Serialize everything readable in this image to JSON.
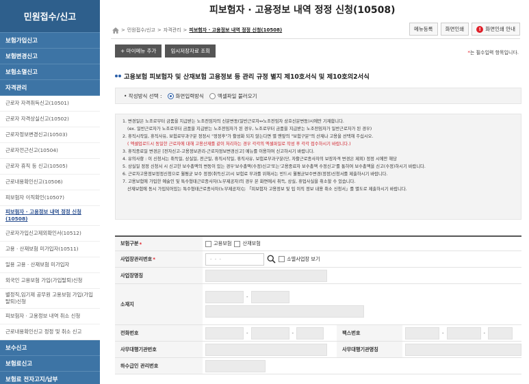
{
  "sidebar": {
    "title": "민원접수/신고",
    "categories_top": [
      "보험가입신고",
      "보험변경신고",
      "보험소멸신고",
      "자격관리"
    ],
    "items": [
      "근로자 자격취득신고(10501)",
      "근로자 자격상실신고(10502)",
      "근로자정보변경신고(10503)",
      "근로자전근신고(10504)",
      "근로자 휴직 등 신고(10505)",
      "근로내용확인신고(10506)",
      "피보험자 이직확인(10507)",
      "피보험자 · 고용정보 내역 정정 신청(10508)",
      "근로자가입신고제외확인서(10512)",
      "고용 · 산재보험 미가입자(10511)",
      "일용 고용 · 산재보험 미가입자",
      "외국인 고용보험 가입(가입탈퇴)신청",
      "별정직,임기제 공무원 고용보험 가입(가입탈퇴)신청",
      "피보험자 · 고용정보 내역 취소 신청",
      "근로내용확인신고 정정 및 취소 신고"
    ],
    "categories_bottom": [
      "보수신고",
      "보험료신고",
      "보험료 전자고지/납부"
    ]
  },
  "header": {
    "title": "피보험자 · 고용정보 내역 정정 신청(10508)",
    "breadcrumb": [
      "민원접수/신고",
      "자격관리",
      "피보험자 · 고용정보 내역 정정 신청(10508)"
    ],
    "buttons": {
      "menu_register": "메뉴등록",
      "print_screen": "화면인쇄",
      "print_guide": "화면인쇄 안내"
    }
  },
  "actions": {
    "add_my_menu": "+ 마이메뉴 추가",
    "temp_lookup": "임시저장자료 조회",
    "required_note": "는 필수입력 항목입니다.",
    "required_star": "*"
  },
  "section": {
    "title": "고용보험 피보험자 및 산재보험 고용정보 등 관리 규정 별지 제10호서식 및 제10호의2서식"
  },
  "method": {
    "label": "• 작성방식 선택 :",
    "option_screen": "화면입력방식",
    "option_excel": "엑셀파일 불러오기",
    "selected": "화면입력방식"
  },
  "notices": [
    "1. 변경일은 노조로부터 금품을 지급받는 노조전임자의 신분변동(일반근로자↔노조전임자 상호신분변동)시에만 기재합니다.",
    "(ex. 일반근로자가 노조로부터 금품을 지급받는 노조전임자가 된 경우, 노조로부터 금품을 지급받는 노조전임자가 일반근로자가 된 경우)",
    "2. 휴직시작일, 휴직사유, 보험료부과구분 정정시 \"정정후\"가 활성화 되지 않는다면 별 맨앞의 \"보험구분\"의 산재나 고용을 선택해 주십시오.",
    "( 엑셀업로드시 동일한 근로자에 대해 고용산재를 같이 처리하는 경우 각각의 엑셀파일로 작성 후 각각 접수하시기 바랍니다.)",
    "3. 휴직종료일 변경은 [전자신고-고용정보관리-근로자정보변경신고] 메뉴를 이용하여 신고하시기 바랍니다.",
    "4. 유의사항 : 이 신청서는 취득일, 상실일, 전근일, 휴직시작일, 휴직사유, 보험료부과구분(단, 자활근로종사자의 보장자격 변경은 제외) 정정 시에만 해당",
    "5. 상실일 정정 신청서 시 신고한 보수총액의 변동이 있는 경우'보수총액(수정)신고'또는'고용종료자 보수총액 수정신고'를 통하여 보수총액을 신고(수정)하시기 바랍니다.",
    "6. 근로자고용정보정정신청으로 월평균 보수 정정(취득신고)시 보험료 부과를 위해서는 반드시 월평균보수변경(정정)신청서를 제출하시기 바랍니다.",
    "7. 고용보험에 가입한 예술인 및 특수형태근로종사자(노무제공자)의 경우 본 화면에서 취득, 상실, 휴업사실을 취소할 수 있습니다.",
    "산재보험에 동시 가입되어있는 특수형태근로종사자(노무제공자)는 「피보험자 고용정보 및 입 이직 정보 내용 취소 신청서」를 별도로 제출하시기 바랍니다."
  ],
  "form": {
    "insurance_type": {
      "label": "보험구분",
      "star": "*",
      "opt_employment": "고용보험",
      "opt_industrial": "산재보험"
    },
    "workplace_no": {
      "label": "사업장관리번호",
      "star": "*",
      "placeholder": "- - -",
      "small_workplace": "소멸사업장 보기"
    },
    "workplace_name": {
      "label": "사업장명칭"
    },
    "address": {
      "label": "소재지",
      "dash": "-"
    },
    "phone": {
      "label": "전화번호",
      "dash": "-"
    },
    "fax": {
      "label": "팩스번호"
    },
    "agency_no": {
      "label": "사무대행기관번호"
    },
    "agency_name": {
      "label": "사무대행기관명칭"
    },
    "sub_no": {
      "label": "하수급인 관리번호"
    }
  }
}
